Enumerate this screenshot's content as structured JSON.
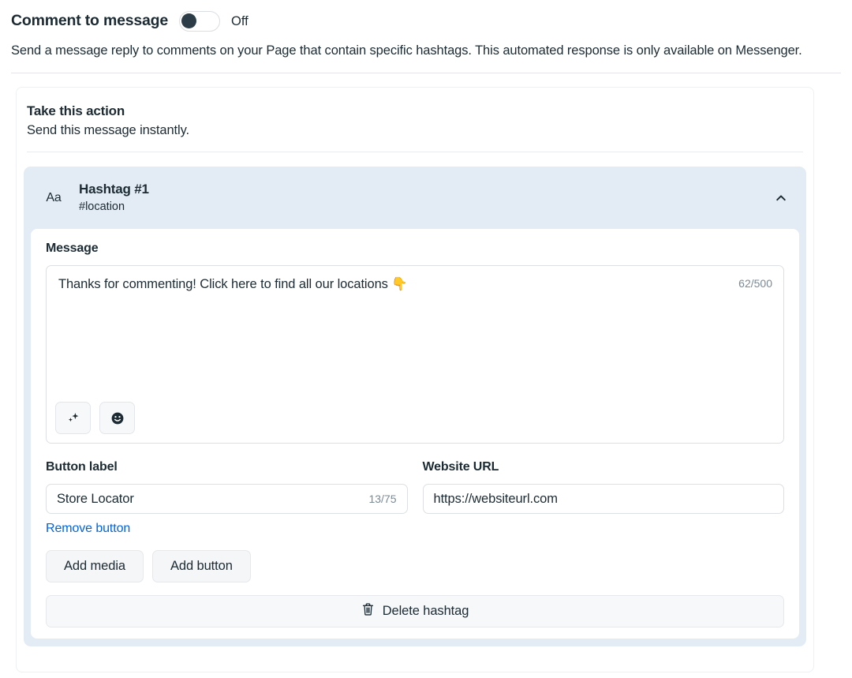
{
  "header": {
    "title": "Comment to message",
    "toggle": {
      "name": "comment-to-message-toggle",
      "state_label": "Off",
      "on": false
    },
    "description": "Send a message reply to comments on your Page that contain specific hashtags. This automated response is only available on Messenger."
  },
  "action": {
    "title": "Take this action",
    "subtitle": "Send this message instantly."
  },
  "hashtag_card": {
    "icon_label": "Aa",
    "name": "Hashtag #1",
    "tag": "#location",
    "collapse_icon": "chevron-up-icon"
  },
  "message": {
    "label": "Message",
    "value": "Thanks for commenting! Click here to find all our locations 👇",
    "counter": "62/500",
    "tools": [
      {
        "name": "ai-sparkle-button",
        "glyph": "✨"
      },
      {
        "name": "emoji-button",
        "glyph": "🙂"
      }
    ]
  },
  "button_label": {
    "label": "Button label",
    "value": "Store Locator",
    "counter": "13/75"
  },
  "website_url": {
    "label": "Website URL",
    "value": "https://websiteurl.com"
  },
  "links": {
    "remove_button": "Remove button"
  },
  "buttons": {
    "add_media": "Add media",
    "add_button": "Add button",
    "delete_hashtag": "Delete hashtag"
  },
  "colors": {
    "accent_link": "#0064e0",
    "card_blue": "#e3ecf5",
    "toggle_knob": "#2d3d47",
    "text_primary": "#1c2b33",
    "text_muted": "#7b8a94"
  }
}
